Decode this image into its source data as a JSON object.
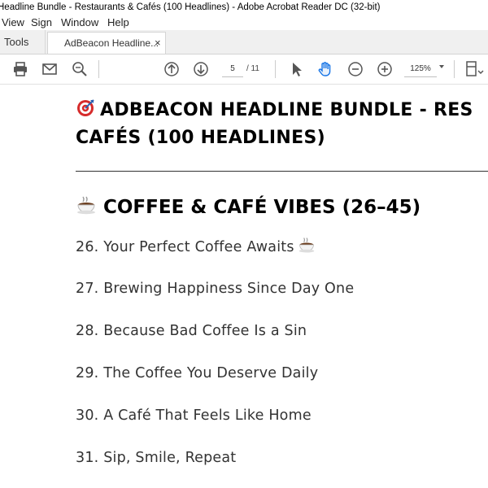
{
  "window": {
    "title": "Headline Bundle - Restaurants & Cafés (100 Headlines) - Adobe Acrobat Reader DC (32-bit)"
  },
  "menu": {
    "items": [
      "View",
      "Sign",
      "Window",
      "Help"
    ]
  },
  "tabs": {
    "tools_label": "Tools",
    "doc_label": "AdBeacon Headline...",
    "close_glyph": "×"
  },
  "toolbar": {
    "icons": [
      "print-icon",
      "email-icon",
      "search-zoom-icon",
      "page-up-icon",
      "page-down-icon",
      "select-arrow-icon",
      "hand-icon",
      "zoom-out-icon",
      "zoom-in-icon",
      "page-layout-icon"
    ],
    "page_current": "5",
    "page_total": "/ 11",
    "zoom": "125%"
  },
  "colors": {
    "accent_blue": "#1473e6",
    "target_red": "#d62b2b",
    "text": "#333333"
  },
  "document": {
    "title_line1": "ADBEACON HEADLINE BUNDLE - RES",
    "title_line2": "CAFÉS (100 HEADLINES)",
    "title_icon": "target-icon",
    "section_heading": "COFFEE & CAFÉ VIBES (26–45)",
    "section_icon": "coffee-cup-icon",
    "headlines": [
      "26. Your Perfect Coffee Awaits",
      "27. Brewing Happiness Since Day One",
      "28. Because Bad Coffee Is a Sin",
      "29. The Coffee You Deserve Daily",
      "30. A Café That Feels Like Home",
      "31. Sip, Smile, Repeat"
    ]
  }
}
